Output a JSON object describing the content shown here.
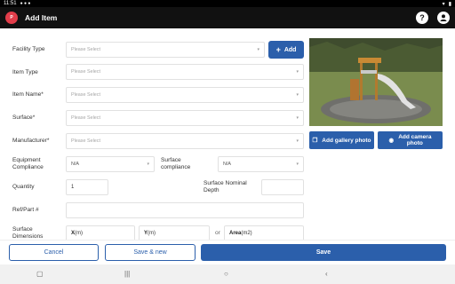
{
  "status_bar": {
    "time": "11:51"
  },
  "app_bar": {
    "logo_text": "P",
    "title": "Add Item",
    "help_label": "?"
  },
  "form": {
    "facility_type": {
      "label": "Facility Type",
      "placeholder": "Please Select"
    },
    "add_button": {
      "icon": "+",
      "label": "Add"
    },
    "item_type": {
      "label": "Item Type",
      "placeholder": "Please Select"
    },
    "item_name": {
      "label": "Item Name*",
      "placeholder": "Please Select"
    },
    "surface": {
      "label": "Surface*",
      "placeholder": "Please Select"
    },
    "manufacturer": {
      "label": "Manufacturer*",
      "placeholder": "Please Select"
    },
    "equipment_compliance": {
      "label_line1": "Equipment",
      "label_line2": "Compliance",
      "value": "N/A"
    },
    "surface_compliance": {
      "label_line1": "Surface",
      "label_line2": "compliance",
      "value": "N/A"
    },
    "quantity": {
      "label": "Quantity",
      "value": "1"
    },
    "surface_nominal_depth": {
      "label_line1": "Surface Nominal",
      "label_line2": "Depth",
      "value": ""
    },
    "ref_part": {
      "label": "Ref/Part #",
      "value": ""
    },
    "surface_dimensions": {
      "label_line1": "Surface",
      "label_line2": "Dimensions",
      "x_label": "X",
      "x_unit": "(m)",
      "y_label": "Y",
      "y_unit": "(m)",
      "or_label": "or",
      "area_label": "Area",
      "area_unit": "(m2)"
    }
  },
  "photo": {
    "gallery_button": "Add gallery photo",
    "camera_button_line1": "Add camera",
    "camera_button_line2": "photo"
  },
  "footer": {
    "cancel": "Cancel",
    "save_new": "Save & new",
    "save": "Save"
  },
  "colors": {
    "primary": "#2b5fab",
    "app_bar": "#111111",
    "logo": "#e23d4a"
  }
}
